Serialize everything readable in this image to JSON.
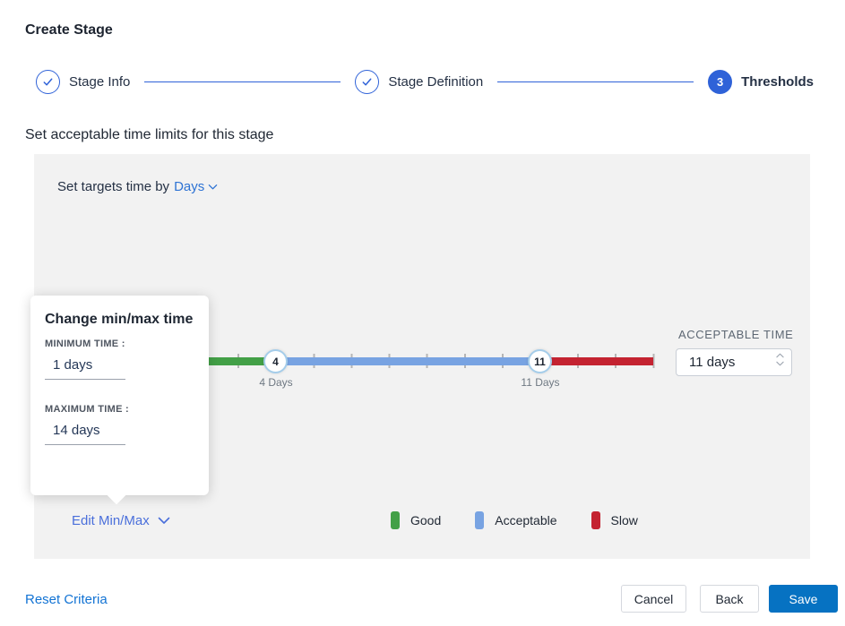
{
  "page": {
    "title": "Create Stage"
  },
  "palette": {
    "step-blue": "#2f62d8",
    "link-blue": "#2e73d4",
    "edit-blue": "#4a6fdb",
    "reset-blue": "#1273d4",
    "save-blue": "#0672c2",
    "panel-gray": "#f2f2f2",
    "tick-gray": "#b5b5b5",
    "handle-border": "#a5cdea",
    "text-dark": "#1f2733",
    "good-green": "#43a047",
    "acceptable-blue": "#78a3e2",
    "slow-red": "#c42331"
  },
  "stepper": {
    "steps": [
      {
        "label": "Stage Info",
        "state": "complete"
      },
      {
        "label": "Stage Definition",
        "state": "complete"
      },
      {
        "label": "Thresholds",
        "state": "active",
        "number": "3"
      }
    ]
  },
  "section": {
    "heading": "Set acceptable time limits for this stage"
  },
  "targets": {
    "prefix": "Set targets time by",
    "unit": "Days"
  },
  "slider": {
    "scale_min_day": 1,
    "scale_max_day": 14,
    "handles": [
      {
        "value": "4",
        "label": "4 Days"
      },
      {
        "value": "11",
        "label": "11 Days"
      }
    ],
    "segments": [
      {
        "name": "Good",
        "from_day": 1,
        "to_day": 4,
        "color": "#43a047"
      },
      {
        "name": "Acceptable",
        "from_day": 4,
        "to_day": 11,
        "color": "#78a3e2"
      },
      {
        "name": "Slow",
        "from_day": 11,
        "to_day": 14,
        "color": "#c42331"
      }
    ]
  },
  "acceptable_time": {
    "label": "ACCEPTABLE TIME",
    "value": "11 days"
  },
  "popover": {
    "title": "Change min/max time",
    "min_label": "MINIMUM TIME :",
    "min_value": "1 days",
    "max_label": "MAXIMUM TIME :",
    "max_value": "14 days"
  },
  "edit_minmax": {
    "label": "Edit Min/Max"
  },
  "legend": [
    {
      "label": "Good"
    },
    {
      "label": "Acceptable"
    },
    {
      "label": "Slow"
    }
  ],
  "footer": {
    "reset": "Reset Criteria",
    "cancel": "Cancel",
    "back": "Back",
    "save": "Save"
  }
}
